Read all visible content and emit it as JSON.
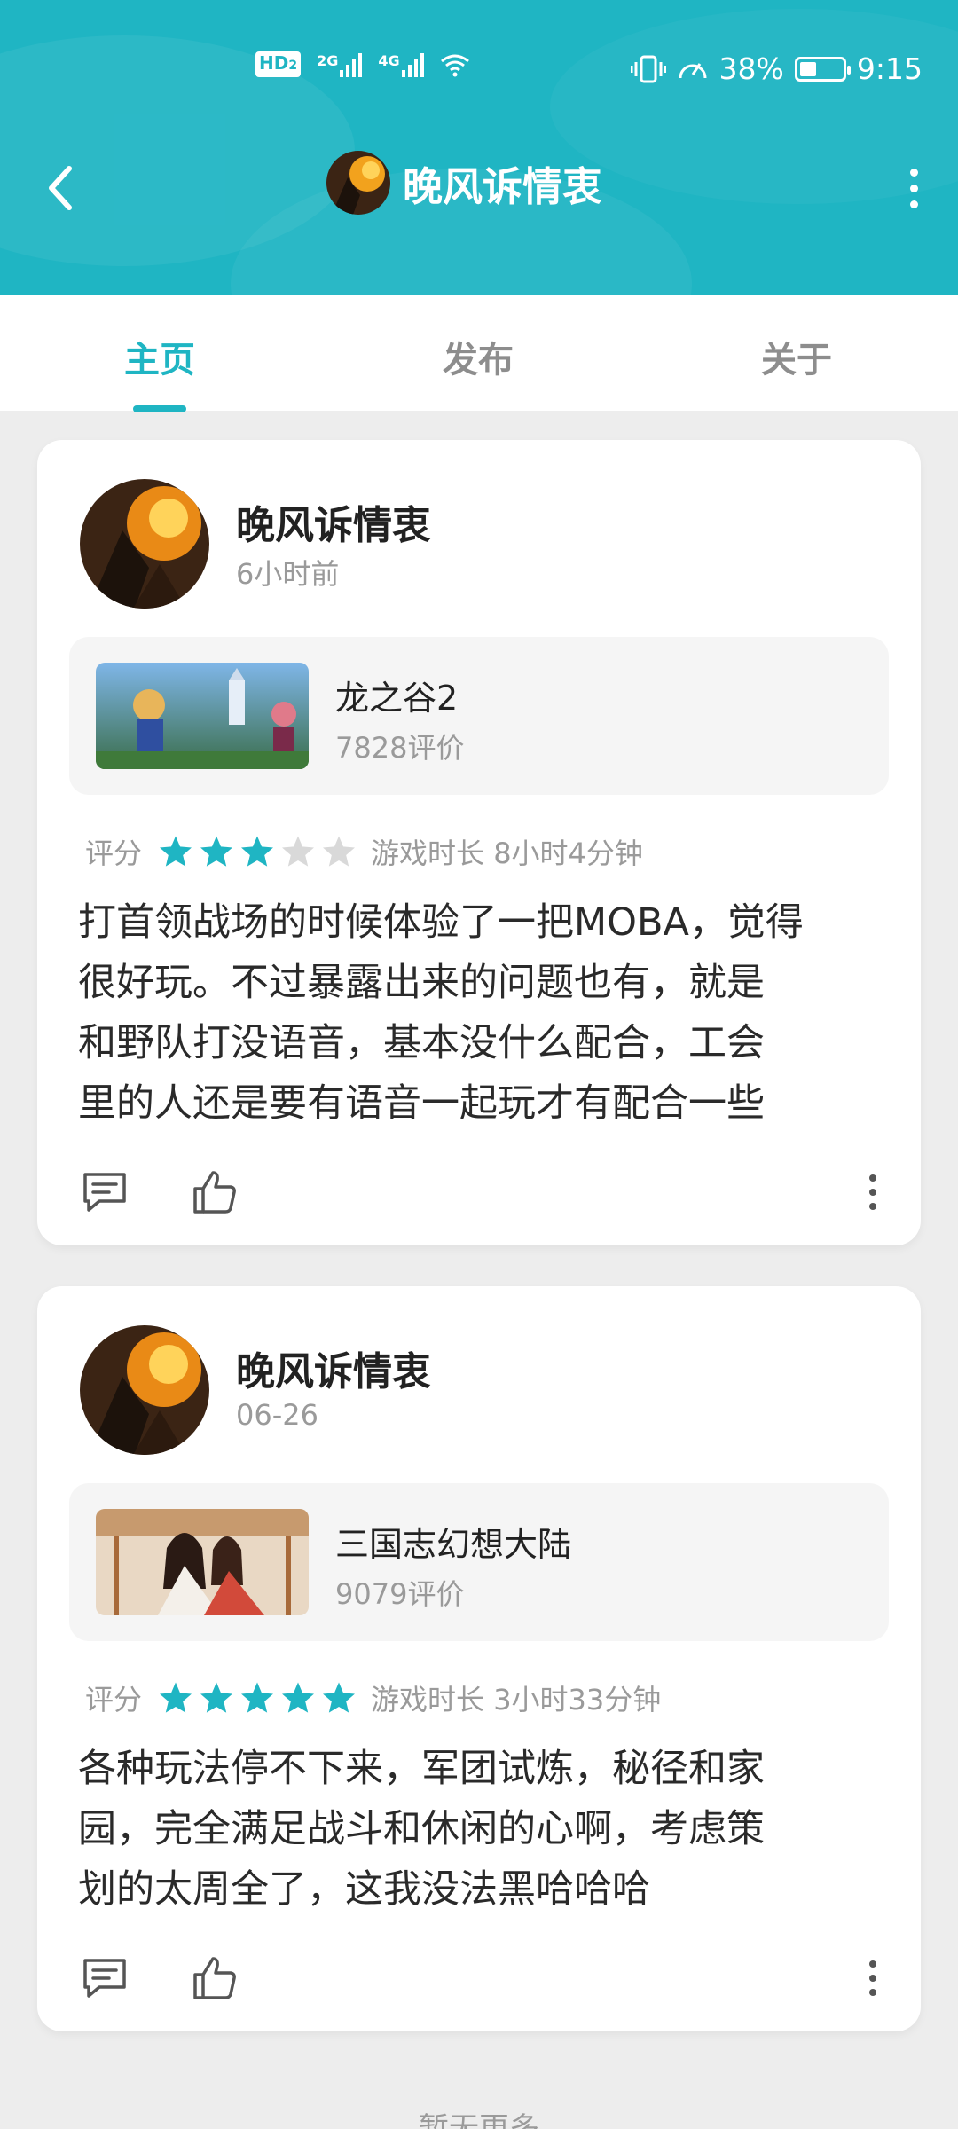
{
  "status_bar": {
    "hd": "HD",
    "hd_sub": "2",
    "net1": "2G",
    "net2": "4G",
    "battery": "38%",
    "time": "9:15"
  },
  "header": {
    "title": "晚风诉情衷",
    "back_icon": "back-arrow-icon",
    "more_icon": "more-vertical-icon"
  },
  "tabs": [
    {
      "label": "主页",
      "active": true
    },
    {
      "label": "发布",
      "active": false
    },
    {
      "label": "关于",
      "active": false
    }
  ],
  "posts": [
    {
      "user": "晚风诉情衷",
      "time": "6小时前",
      "game_name": "龙之谷2",
      "game_reviews": "7828评价",
      "rating_label": "评分",
      "stars": 3,
      "playtime": "游戏时长 8小时4分钟",
      "review_lines": [
        "打首领战场的时候体验了一把MOBA，觉得",
        "很好玩。不过暴露出来的问题也有，就是",
        "和野队打没语音，基本没什么配合，工会",
        "里的人还是要有语音一起玩才有配合一些"
      ]
    },
    {
      "user": "晚风诉情衷",
      "time": "06-26",
      "game_name": "三国志幻想大陆",
      "game_reviews": "9079评价",
      "rating_label": "评分",
      "stars": 5,
      "playtime": "游戏时长 3小时33分钟",
      "review_lines": [
        "各种玩法停不下来，军团试炼，秘径和家",
        "园，完全满足战斗和休闲的心啊，考虑策",
        "划的太周全了，这我没法黑哈哈哈"
      ]
    }
  ],
  "footer": "暂无更多",
  "colors": {
    "accent": "#1fb5c3",
    "star_on": "#1fb5c3",
    "star_off": "#d9d9d9"
  }
}
